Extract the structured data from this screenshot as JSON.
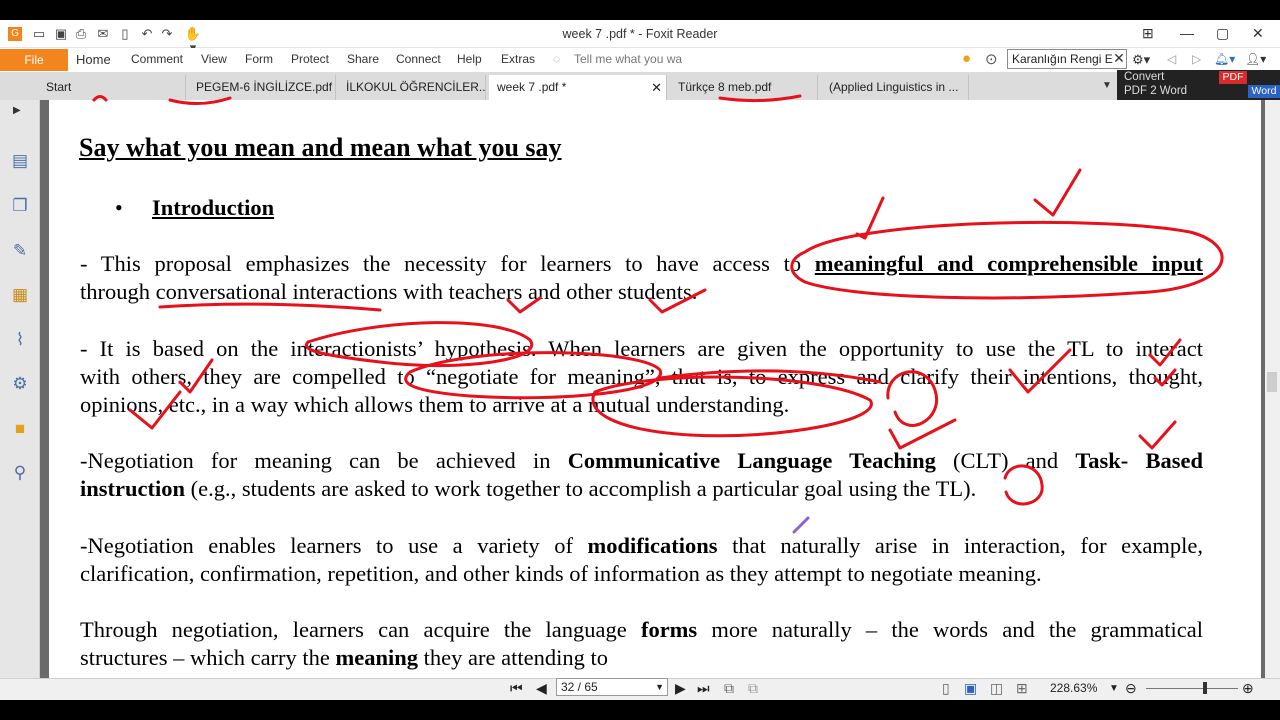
{
  "window": {
    "title": "week 7 .pdf * - Foxit Reader"
  },
  "ribbon": {
    "file": "File",
    "menus": [
      "Home",
      "Comment",
      "View",
      "Form",
      "Protect",
      "Share",
      "Connect",
      "Help",
      "Extras"
    ],
    "tell_me": "Tell me what you wa",
    "search_value": "Karanlığın Rengi E",
    "convert_line1": "Convert",
    "convert_line2": "PDF 2 Word",
    "convert_badge_pdf": "PDF",
    "convert_badge_word": "Word"
  },
  "tabs": [
    "Start",
    "PEGEM-6 İNGİLİZCE.pdf",
    "İLKOKUL ÖĞRENCİLER...",
    "week 7 .pdf *",
    "Türkçe 8 meb.pdf",
    "(Applied Linguistics in ..."
  ],
  "document": {
    "heading": "Say what you mean and mean what you say",
    "bullet": "•",
    "intro_title": "Introduction",
    "p1_l1_a": "- This proposal emphasizes the necessity for learners to have access to ",
    "p1_l1_b": "meaningful and comprehensible input",
    "p1_l2": "through conversational interactions with teachers and other students.",
    "p2_l1": "- It is based on the interactionists’ hypothesis. When learners are given the opportunity to use the TL to interact",
    "p2_l2": "with others, they are compelled to “negotiate for meaning”, that is, to express and clarify their intentions, thought,",
    "p2_l3": "opinions, etc., in a way which allows them to arrive at a mutual understanding.",
    "p3_l1_a": "-Negotiation for meaning can be achieved in ",
    "p3_l1_b": "Communicative Language Teaching",
    "p3_l1_c": " (CLT) and ",
    "p3_l1_d": "Task- Based",
    "p3_l2_a": "instruction",
    "p3_l2_b": " (e.g., students are asked to work together to accomplish a particular goal using the TL).",
    "p4_l1_a": "-Negotiation enables learners to use a variety of ",
    "p4_l1_b": "modifications",
    "p4_l1_c": " that naturally arise in interaction, for example,",
    "p4_l2": "clarification, confirmation, repetition, and other kinds of information as they attempt to negotiate meaning.",
    "p5_l1_a": "Through negotiation, learners can acquire the language ",
    "p5_l1_b": "forms",
    "p5_l1_c": " more naturally – the words and the grammatical",
    "p5_l2_a": "structures – which carry the ",
    "p5_l2_b": "meaning",
    "p5_l2_c": " they are attending to"
  },
  "status": {
    "page": "32 / 65",
    "zoom": "228.63%"
  },
  "colors": {
    "accent": "#f2851e",
    "ink": "#e8101a"
  }
}
